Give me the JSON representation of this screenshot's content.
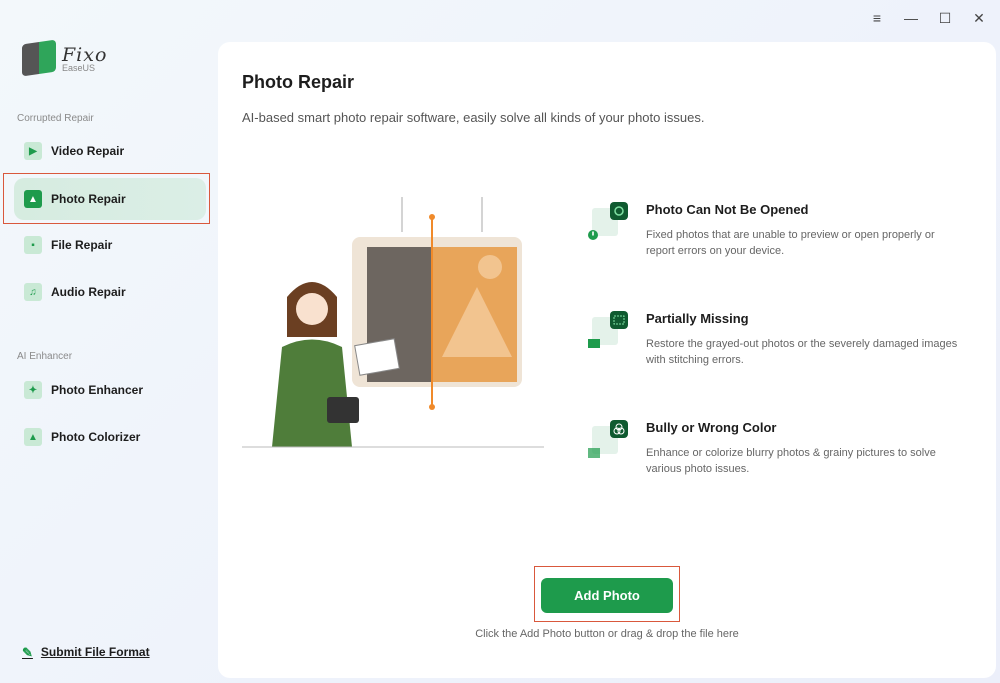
{
  "window": {
    "menu": "≡",
    "minimize": "—",
    "maximize": "☐",
    "close": "✕"
  },
  "logo": {
    "name": "Fixo",
    "brand": "EaseUS"
  },
  "sidebar": {
    "section1": "Corrupted Repair",
    "repair_items": [
      {
        "label": "Video Repair",
        "icon": "▶"
      },
      {
        "label": "Photo Repair",
        "icon": "▲"
      },
      {
        "label": "File Repair",
        "icon": "▪"
      },
      {
        "label": "Audio Repair",
        "icon": "♫"
      }
    ],
    "section2": "AI Enhancer",
    "enhancer_items": [
      {
        "label": "Photo Enhancer",
        "icon": "✦"
      },
      {
        "label": "Photo Colorizer",
        "icon": "▲"
      }
    ],
    "submit": "Submit File Format"
  },
  "main": {
    "title": "Photo Repair",
    "subtitle": "AI-based smart photo repair software, easily solve all kinds of your photo issues.",
    "features": [
      {
        "title": "Photo Can Not Be Opened",
        "desc": "Fixed photos that are unable to preview or open properly or report errors on your device."
      },
      {
        "title": "Partially Missing",
        "desc": "Restore the grayed-out photos or the severely damaged images with stitching errors."
      },
      {
        "title": "Bully or Wrong Color",
        "desc": "Enhance or colorize blurry photos & grainy pictures to solve various photo issues."
      }
    ],
    "button": "Add Photo",
    "hint": "Click the Add Photo button or drag & drop the file here"
  },
  "colors": {
    "accent": "#1e9b4c",
    "highlight": "#d9583c"
  }
}
